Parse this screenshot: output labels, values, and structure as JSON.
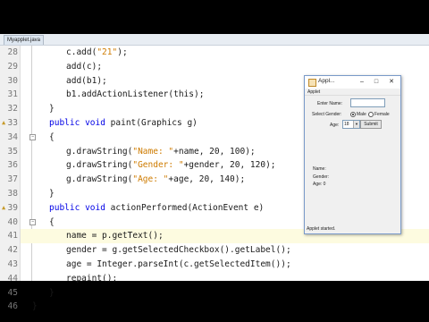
{
  "editor": {
    "tab_label": "Myapplet.java",
    "lines": [
      {
        "no": "28",
        "indent": 3,
        "text": "c.add(\"21\");",
        "icon": ""
      },
      {
        "no": "29",
        "indent": 3,
        "text": "add(c);",
        "icon": ""
      },
      {
        "no": "30",
        "indent": 3,
        "text": "add(b1);",
        "icon": ""
      },
      {
        "no": "31",
        "indent": 3,
        "text": "b1.addActionListener(this);",
        "icon": ""
      },
      {
        "no": "32",
        "indent": 2,
        "text": "}",
        "icon": ""
      },
      {
        "no": "33",
        "indent": 2,
        "text": "public void paint(Graphics g)",
        "icon": "override"
      },
      {
        "no": "34",
        "indent": 2,
        "text": "{",
        "icon": "fold"
      },
      {
        "no": "35",
        "indent": 3,
        "text": "g.drawString(\"Name: \"+name, 20, 100);",
        "icon": ""
      },
      {
        "no": "36",
        "indent": 3,
        "text": "g.drawString(\"Gender: \"+gender, 20, 120);",
        "icon": ""
      },
      {
        "no": "37",
        "indent": 3,
        "text": "g.drawString(\"Age: \"+age, 20, 140);",
        "icon": ""
      },
      {
        "no": "38",
        "indent": 2,
        "text": "}",
        "icon": ""
      },
      {
        "no": "39",
        "indent": 2,
        "text": "public void actionPerformed(ActionEvent e)",
        "icon": "override"
      },
      {
        "no": "40",
        "indent": 2,
        "text": "{",
        "icon": "fold"
      },
      {
        "no": "41",
        "indent": 3,
        "text": "name = p.getText();",
        "icon": "",
        "highlight": true
      },
      {
        "no": "42",
        "indent": 3,
        "text": "gender = g.getSelectedCheckbox().getLabel();",
        "icon": ""
      },
      {
        "no": "43",
        "indent": 3,
        "text": "age = Integer.parseInt(c.getSelectedItem());",
        "icon": ""
      },
      {
        "no": "44",
        "indent": 3,
        "text": "repaint();",
        "icon": ""
      },
      {
        "no": "45",
        "indent": 2,
        "text": "}",
        "icon": ""
      },
      {
        "no": "46",
        "indent": 1,
        "text": "}",
        "icon": ""
      }
    ]
  },
  "applet_window": {
    "title": "Appl...",
    "menu_label": "Applet",
    "name_label": "Enter Name:",
    "name_value": "",
    "gender_label": "Select Gender:",
    "male_label": "Male",
    "female_label": "Female",
    "age_label": "Age:",
    "age_value": "18",
    "submit_label": "Submit",
    "out_name": "Name:",
    "out_gender": "Gender:",
    "out_age": "Age: 0",
    "status": "Applet started."
  },
  "colors": {
    "keyword": "#0000e6",
    "string": "#ce7b00",
    "number": "#000000"
  }
}
